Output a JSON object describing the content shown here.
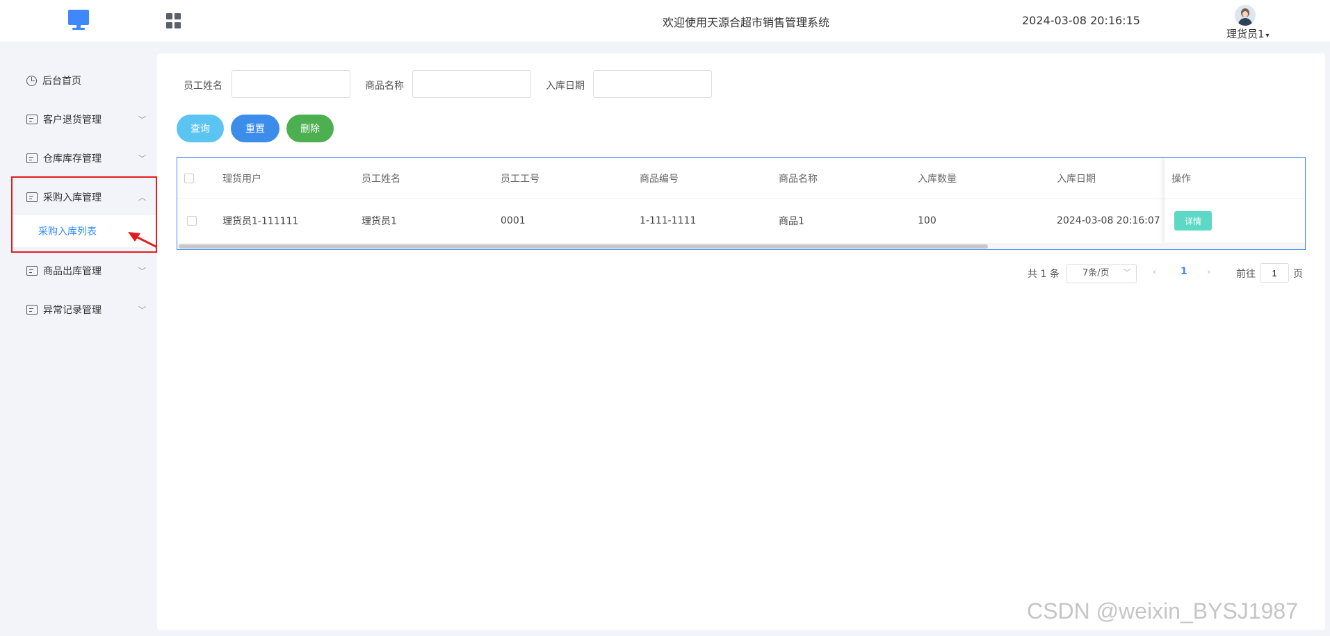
{
  "header": {
    "title": "欢迎使用天源合超市销售管理系统",
    "datetime": "2024-03-08 20:16:15",
    "user": "理货员1",
    "logo_icon": "monitor-icon",
    "menu_icon": "apps-grid-icon",
    "accent": "#3f87ff"
  },
  "sidebar": {
    "items": [
      {
        "label": "后台首页",
        "icon": "clock-icon"
      },
      {
        "label": "客户退货管理",
        "icon": "card-icon"
      },
      {
        "label": "仓库库存管理",
        "icon": "card-icon"
      },
      {
        "label": "采购入库管理",
        "icon": "card-icon",
        "expanded": true
      },
      {
        "label": "商品出库管理",
        "icon": "card-icon"
      },
      {
        "label": "异常记录管理",
        "icon": "card-icon"
      }
    ],
    "sub_item": "采购入库列表"
  },
  "search": {
    "employee_label": "员工姓名",
    "product_label": "商品名称",
    "date_label": "入库日期",
    "employee_value": "",
    "product_value": "",
    "date_value": ""
  },
  "buttons": {
    "query": "查询",
    "reset": "重置",
    "delete": "删除"
  },
  "table": {
    "headers": [
      "理货用户",
      "员工姓名",
      "员工工号",
      "商品编号",
      "商品名称",
      "入库数量",
      "入库日期"
    ],
    "op_header": "操作",
    "rows": [
      {
        "cells": [
          "理货员1-111111",
          "理货员1",
          "0001",
          "1-111-1111",
          "商品1",
          "100",
          "2024-03-08 20:16:07"
        ],
        "action": "详情"
      }
    ]
  },
  "pagination": {
    "total": "共 1 条",
    "page_size": "7条/页",
    "current_page": "1",
    "goto_label": "前往",
    "goto_value": "1",
    "page_suffix": "页"
  },
  "watermark": "CSDN @weixin_BYSJ1987"
}
